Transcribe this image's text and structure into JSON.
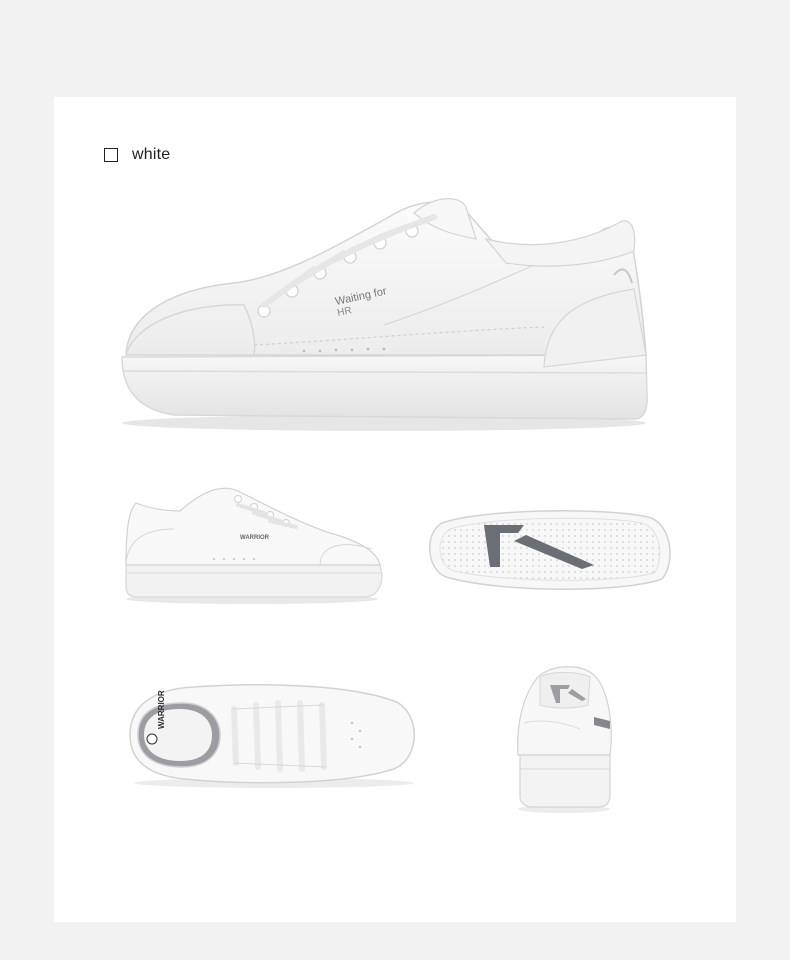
{
  "color_option": {
    "label": "white",
    "swatch": "#ffffff",
    "selected": false
  },
  "hero_shoe": {
    "print": "Waiting for",
    "print_line2": "HR"
  },
  "side_shoe": {
    "brand": "WARRIOR"
  },
  "top_shoe": {
    "insole_brand": "WARRIOR"
  },
  "colors": {
    "background": "#f2f2f2",
    "card": "#ffffff",
    "accent_gray": "#6b6e74"
  }
}
